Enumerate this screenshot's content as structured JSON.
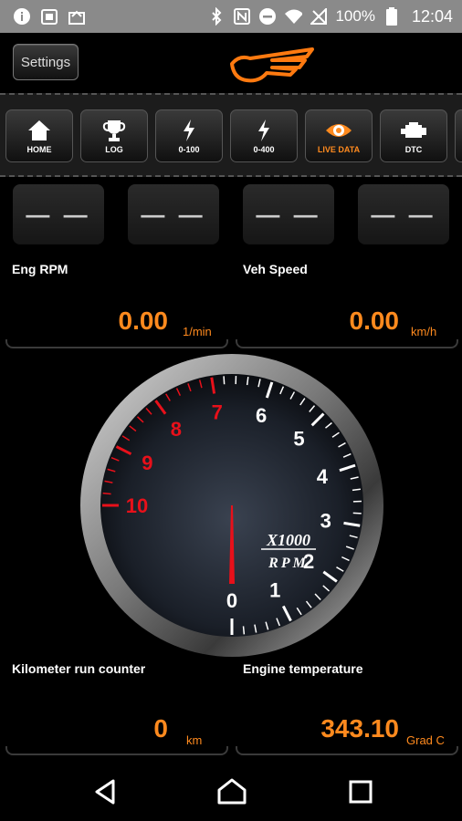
{
  "status_bar": {
    "battery": "100%",
    "time": "12:04",
    "icons": [
      "info-icon",
      "calendar-icon",
      "inbox-icon",
      "bluetooth-icon",
      "nfc-icon",
      "do-not-disturb-icon",
      "wifi-icon",
      "signal-icon",
      "battery-icon"
    ]
  },
  "header": {
    "settings_label": "Settings",
    "logo": "wing-logo",
    "accent": "#ff8a1e"
  },
  "tabs": [
    {
      "label": "HOME",
      "icon": "home-icon",
      "active": false
    },
    {
      "label": "LOG",
      "icon": "trophy-icon",
      "active": false
    },
    {
      "label": "0-100",
      "icon": "lightning-icon",
      "active": false
    },
    {
      "label": "0-400",
      "icon": "lightning-icon",
      "active": false
    },
    {
      "label": "LIVE DATA",
      "icon": "eye-icon",
      "active": true
    },
    {
      "label": "DTC",
      "icon": "engine-icon",
      "active": false
    }
  ],
  "value_boxes": [
    "— —",
    "— —",
    "— —",
    "— —"
  ],
  "metrics": {
    "eng_rpm": {
      "label": "Eng RPM",
      "value": "0.00",
      "unit": "1/min"
    },
    "veh_speed": {
      "label": "Veh Speed",
      "value": "0.00",
      "unit": "km/h"
    },
    "km_counter": {
      "label": "Kilometer run counter",
      "value": "0",
      "unit": "km"
    },
    "engine_temp": {
      "label": "Engine temperature",
      "value": "343.10",
      "unit": "Grad C"
    }
  },
  "gauge": {
    "ticks": [
      "0",
      "1",
      "2",
      "3",
      "4",
      "5",
      "6",
      "7",
      "8",
      "9",
      "10"
    ],
    "redline_from": 7,
    "needle_value": 0,
    "unit_line1": "X1000",
    "unit_line2": "RPM"
  },
  "nav": {
    "icons": [
      "back-icon",
      "home-icon",
      "recents-icon"
    ]
  }
}
